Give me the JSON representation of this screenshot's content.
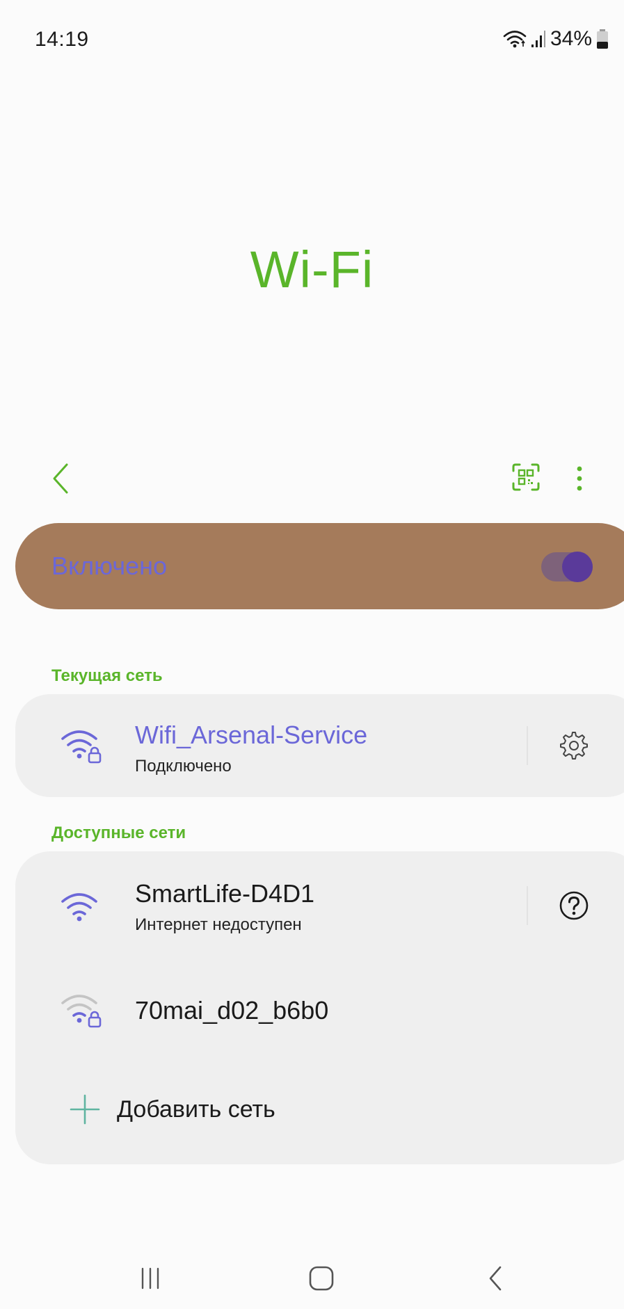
{
  "status_bar": {
    "time": "14:19",
    "battery_text": "34%",
    "icons": [
      "wifi-icon",
      "signal-icon",
      "battery-icon"
    ]
  },
  "page": {
    "title": "Wi-Fi"
  },
  "action_bar": {
    "icons": [
      "back-icon",
      "qr-code-icon",
      "more-options-icon"
    ]
  },
  "wifi_toggle": {
    "label": "Включено",
    "state": "on"
  },
  "current_network": {
    "section_title": "Текущая сеть",
    "name": "Wifi_Arsenal-Service",
    "status": "Подключено",
    "secured": true,
    "action_icon": "gear-icon"
  },
  "available_networks": {
    "section_title": "Доступные сети",
    "items": [
      {
        "name": "SmartLife-D4D1",
        "status": "Интернет недоступен",
        "secured": false,
        "action_icon": "help-icon"
      },
      {
        "name": "70mai_d02_b6b0",
        "status": "",
        "secured": true,
        "action_icon": ""
      }
    ],
    "add_label": "Добавить сеть"
  },
  "nav_bar": {
    "icons": [
      "recent-apps-icon",
      "home-icon",
      "nav-back-icon"
    ]
  },
  "colors": {
    "accent": "#5ab52a",
    "link": "#6b67d8",
    "toggle_bar": "#a57b5b",
    "card": "#efefef",
    "wifi_icon_active": "#6b67d8",
    "wifi_icon_weak": "#bdbdbd"
  }
}
